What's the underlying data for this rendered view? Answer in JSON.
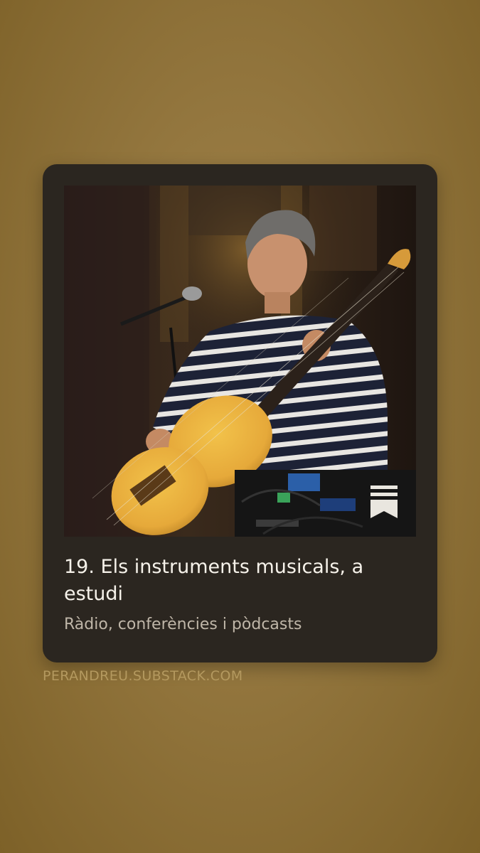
{
  "post": {
    "title": "19. Els instruments musicals, a estudi",
    "subtitle": "Ràdio, conferències i pòdcasts"
  },
  "footer": {
    "domain": "PERANDREU.SUBSTACK.COM"
  },
  "image": {
    "description_icon": "substack-bookmark-icon"
  },
  "colors": {
    "background": "#94773f",
    "card": "#2b2620",
    "title": "#f6f2ea",
    "subtitle": "#bfb6a8",
    "domain": "#b4995f"
  }
}
